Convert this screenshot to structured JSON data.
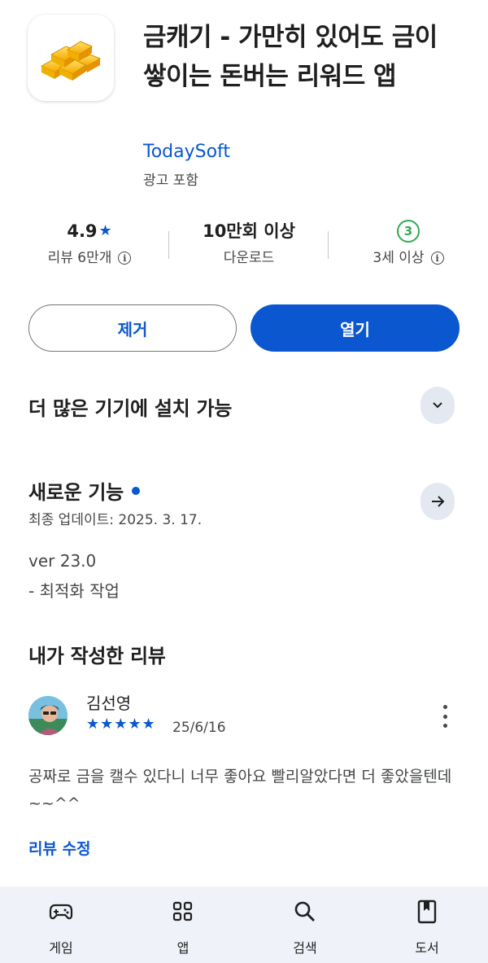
{
  "app": {
    "title": "금캐기 - 가만히 있어도 금이 쌓이는 돈버는 리워드 앱",
    "developer": "TodaySoft",
    "ads_note": "광고 포함",
    "icon": "gold-bars-icon"
  },
  "stats": {
    "rating": {
      "value": "4.9",
      "star": "★",
      "label": "리뷰 6만개"
    },
    "downloads": {
      "value": "10만회 이상",
      "label": "다운로드"
    },
    "age": {
      "badge": "3",
      "label": "3세 이상"
    }
  },
  "actions": {
    "remove_label": "제거",
    "open_label": "열기"
  },
  "more_devices": {
    "title": "더 많은 기기에 설치 가능"
  },
  "whats_new": {
    "title": "새로운 기능",
    "updated": "최종 업데이트: 2025. 3. 17.",
    "version": "ver 23.0",
    "notes": "- 최적화 작업"
  },
  "my_review": {
    "title": "내가 작성한 리뷰",
    "reviewer": "김선영",
    "stars": "★★★★★",
    "rating": 5,
    "date": "25/6/16",
    "text": "공짜로 금을 캘수 있다니 너무 좋아요 빨리알았다면 더 좋았을텐데~~^^",
    "edit_label": "리뷰 수정"
  },
  "bottom_nav": {
    "items": [
      {
        "label": "게임",
        "icon": "gamepad-icon"
      },
      {
        "label": "앱",
        "icon": "apps-grid-icon"
      },
      {
        "label": "검색",
        "icon": "search-icon"
      },
      {
        "label": "도서",
        "icon": "bookmark-icon"
      }
    ]
  },
  "colors": {
    "accent": "#0b57d0",
    "age_badge": "#34a853",
    "nav_bg": "#eff2f8"
  }
}
